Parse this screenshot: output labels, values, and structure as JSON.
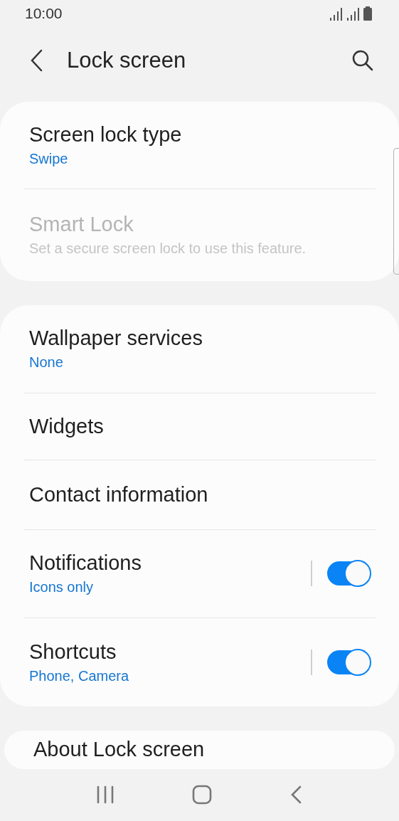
{
  "status_bar": {
    "time": "10:00"
  },
  "header": {
    "title": "Lock screen"
  },
  "groups": [
    {
      "items": [
        {
          "kind": "value",
          "title": "Screen lock type",
          "subtitle": "Swipe",
          "disabled": false
        },
        {
          "kind": "value",
          "title": "Smart Lock",
          "subtitle": "Set a secure screen lock to use this feature.",
          "disabled": true
        }
      ]
    },
    {
      "items": [
        {
          "kind": "value",
          "title": "Wallpaper services",
          "subtitle": "None",
          "disabled": false
        },
        {
          "kind": "plain",
          "title": "Widgets",
          "disabled": false
        },
        {
          "kind": "plain",
          "title": "Contact information",
          "disabled": false
        },
        {
          "kind": "switch",
          "title": "Notifications",
          "subtitle": "Icons only",
          "disabled": false,
          "on": true
        },
        {
          "kind": "switch",
          "title": "Shortcuts",
          "subtitle": "Phone, Camera",
          "disabled": false,
          "on": true
        }
      ]
    },
    {
      "items": [
        {
          "kind": "plain",
          "title": "About Lock screen",
          "disabled": false
        }
      ]
    }
  ]
}
